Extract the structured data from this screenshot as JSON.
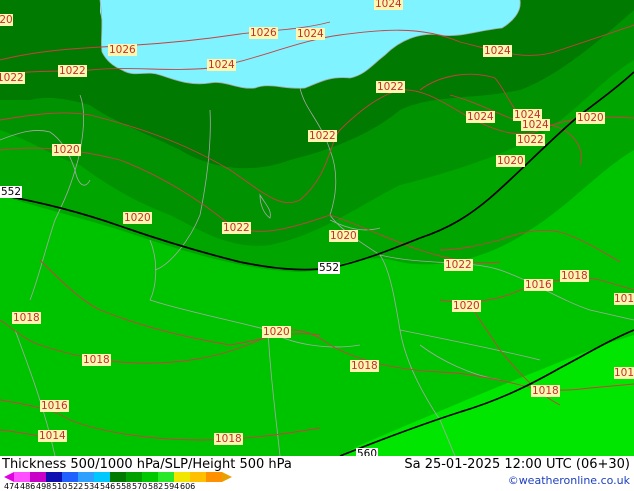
{
  "title": "Thickness 500/1000 hPa/SLP/Height 500 hPa",
  "datetime": "Sa 25-01-2025 12:00 UTC (06+30)",
  "credit": "©weatheronline.co.uk",
  "colors": {
    "sea": "#7ff3ff",
    "thickness_534": "#007a00",
    "thickness_540": "#009200",
    "thickness_546": "#00a500",
    "thickness_552": "#00c300",
    "thickness_558": "#00e600",
    "isobar": "#c84040",
    "border": "#a0a0a0",
    "label_bg": "#fff7b0"
  },
  "colorbar": {
    "ticks": [
      "474",
      "486",
      "498",
      "510",
      "522",
      "534",
      "546",
      "558",
      "570",
      "582",
      "594",
      "606"
    ],
    "swatches": [
      "#ff50ff",
      "#c800c8",
      "#1010b0",
      "#2060ff",
      "#30a0ff",
      "#00c8ff",
      "#007a00",
      "#00a000",
      "#00c800",
      "#28e828",
      "#f0e600",
      "#ffc000",
      "#ff9000"
    ]
  },
  "isobar_labels": [
    "1024",
    "1026",
    "1026",
    "1024",
    "1022",
    "1024",
    "1022",
    "1024",
    "1022",
    "1020",
    "1022",
    "1024",
    "1024",
    "1020",
    "1024",
    "1022",
    "1020",
    "1020",
    "1020",
    "1022",
    "1020",
    "1022",
    "1018",
    "1016",
    "1018",
    "1020",
    "1018",
    "1018",
    "1018",
    "1016",
    "1014",
    "1018",
    "1016",
    "1018",
    "1020",
    "1020",
    "1016",
    "1018"
  ],
  "thickness_labels": [
    "552",
    "552",
    "560"
  ]
}
